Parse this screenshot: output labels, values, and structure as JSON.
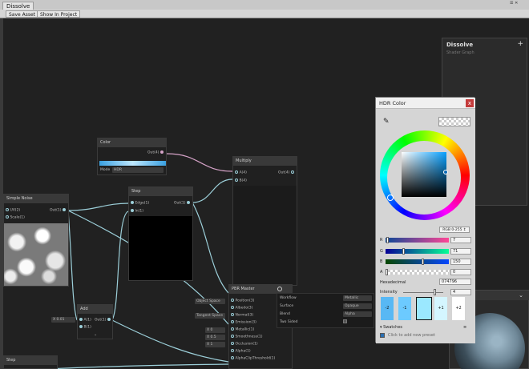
{
  "window": {
    "tab_title": "Dissolve",
    "toolbar": {
      "save_asset": "Save Asset",
      "show_in_project": "Show In Project"
    },
    "controls": "☰ ✕"
  },
  "blackboard": {
    "title": "Dissolve",
    "subtitle": "Shader Graph",
    "add": "+"
  },
  "nodes": {
    "color": {
      "title": "Color",
      "out": "Out(4)",
      "mode_label": "Mode",
      "mode_value": "HDR",
      "swatch_color": "#6ac8ff"
    },
    "multiply": {
      "title": "Multiply",
      "a": "A(4)",
      "b": "B(4)",
      "out": "Out(4)"
    },
    "step": {
      "title": "Step",
      "edge": "Edge(1)",
      "in": "In(1)",
      "out": "Out(1)"
    },
    "simple_noise": {
      "title": "Simple Noise",
      "uv": "UV(2)",
      "scale": "Scale(1)",
      "out": "Out(1)"
    },
    "add": {
      "title": "Add",
      "a": "A(1)",
      "b": "B(1)",
      "out": "Out(1)",
      "a_value": "X 0.01"
    },
    "pbr_master": {
      "title": "PBR Master",
      "pins": [
        "Position(3)",
        "Albedo(3)",
        "Normal(3)",
        "Emission(3)",
        "Metallic(1)",
        "Smoothness(1)",
        "Occlusion(1)",
        "Alpha(1)",
        "AlphaClipThreshold(1)"
      ],
      "tags": [
        "Object Space",
        "",
        "Tangent Space",
        "",
        "X 0",
        "X 0.5",
        "X 1",
        "",
        ""
      ],
      "settings": [
        {
          "label": "Workflow",
          "value": "Metallic"
        },
        {
          "label": "Surface",
          "value": "Opaque"
        },
        {
          "label": "Blend",
          "value": "Alpha"
        },
        {
          "label": "Two Sided",
          "value": ""
        }
      ]
    },
    "bottom_left": {
      "title": "Step"
    }
  },
  "color_picker": {
    "title": "HDR Color",
    "close": "x",
    "mode_button": "RGB 0-255 ↕",
    "channels": [
      {
        "label": "R",
        "value": "7",
        "fraction": 0.03
      },
      {
        "label": "G",
        "value": "71",
        "fraction": 0.28
      },
      {
        "label": "B",
        "value": "150",
        "fraction": 0.59
      },
      {
        "label": "A",
        "value": "0",
        "fraction": 0.0
      }
    ],
    "hex_label": "Hexadecimal",
    "hex_value": "074796",
    "intensity_label": "Intensity",
    "intensity_value": "4",
    "intensity_steps": [
      "-2",
      "-1",
      "",
      "+1",
      "+2"
    ],
    "swatches_label": "Swatches",
    "swatches_menu": "≡",
    "add_preset": "Click to add new preset",
    "current_color": "#074796"
  }
}
